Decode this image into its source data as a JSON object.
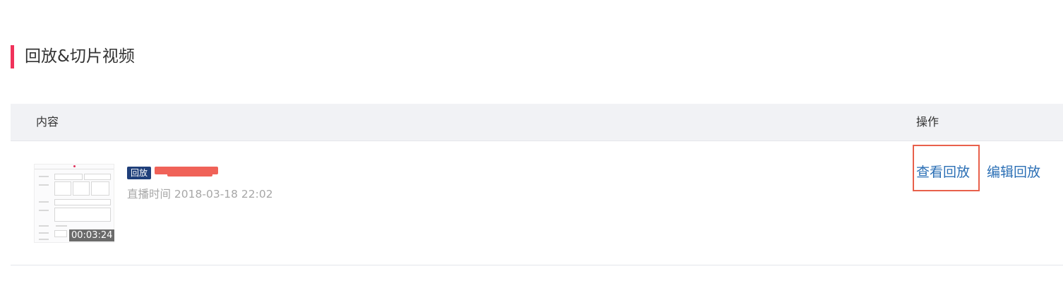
{
  "section": {
    "title": "回放&切片视频"
  },
  "table": {
    "header": {
      "content": "内容",
      "operations": "操作"
    },
    "rows": [
      {
        "badge": "回放",
        "live_time": "直播时间 2018-03-18 22:02",
        "duration": "00:03:24",
        "actions": {
          "view": "查看回放",
          "edit": "编辑回放"
        }
      }
    ]
  },
  "colors": {
    "accent_bar": "#f0325a",
    "badge_bg": "#1f3f7a",
    "link": "#2b6fb5",
    "focus_border": "#e8604b"
  }
}
